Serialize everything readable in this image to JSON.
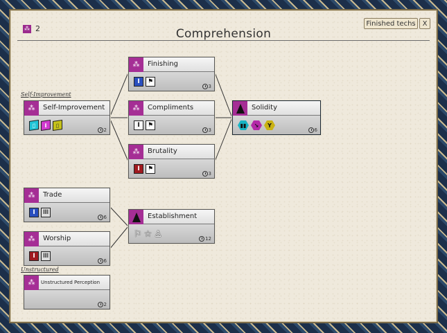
{
  "header": {
    "count": "2",
    "title": "Comprehension",
    "finished_label": "Finished techs",
    "close_label": "X"
  },
  "sections": {
    "self_improvement": "Self-Improvement",
    "unstructured": "Unstructured"
  },
  "nodes": {
    "self_improvement": {
      "label": "Self-Improvement",
      "cost": "2",
      "icons": [
        "cyan-cube-icon",
        "pink-cube-icon",
        "yellow-cube-icon"
      ]
    },
    "finishing": {
      "label": "Finishing",
      "cost": "3",
      "icons": [
        "blue-pillar-icon",
        "flag-icon"
      ]
    },
    "compliments": {
      "label": "Compliments",
      "cost": "3",
      "icons": [
        "white-pillar-icon",
        "flag-icon"
      ]
    },
    "brutality": {
      "label": "Brutality",
      "cost": "3",
      "icons": [
        "red-pillar-icon",
        "flag-icon"
      ]
    },
    "solidity": {
      "label": "Solidity",
      "cost": "6",
      "icons": [
        "cyan-hex-icon",
        "pink-hex-icon",
        "yellow-hex-icon"
      ]
    },
    "trade": {
      "label": "Trade",
      "cost": "6",
      "icons": [
        "blue-pillar-icon",
        "grey-pillar-icon"
      ]
    },
    "worship": {
      "label": "Worship",
      "cost": "6",
      "icons": [
        "red-pillar-icon",
        "grey-pillar-icon"
      ]
    },
    "establishment": {
      "label": "Establishment",
      "cost": "12",
      "icons": [
        "white-flag-icon",
        "star-icon",
        "person-icon"
      ]
    },
    "unstructured_perception": {
      "label": "Unstructured Perception",
      "cost": "2",
      "icons": []
    }
  },
  "colors": {
    "accent_purple": "#a52e95",
    "border_blue": "#1c2f4a",
    "parchment": "#efe9dc"
  }
}
